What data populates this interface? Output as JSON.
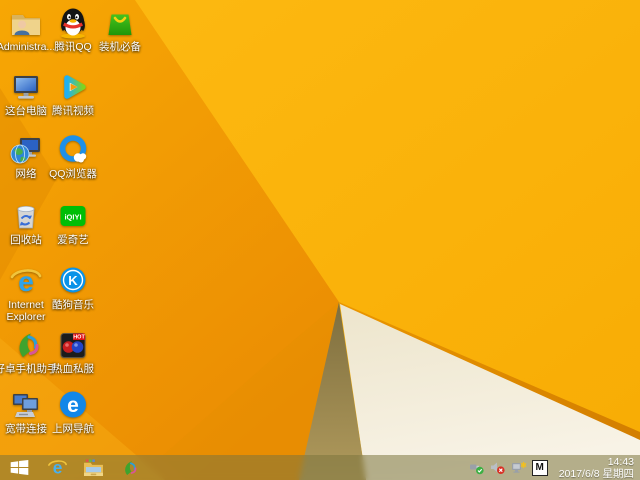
{
  "desktop": {
    "icons": [
      {
        "label": "Administra...",
        "name": "admin-folder"
      },
      {
        "label": "腾讯QQ",
        "name": "tencent-qq"
      },
      {
        "label": "装机必备",
        "name": "essential-apps"
      },
      {
        "label": "这台电脑",
        "name": "this-pc"
      },
      {
        "label": "腾讯视频",
        "name": "tencent-video"
      },
      {
        "label": "网络",
        "name": "network"
      },
      {
        "label": "QQ浏览器",
        "name": "qq-browser"
      },
      {
        "label": "回收站",
        "name": "recycle-bin"
      },
      {
        "label": "爱奇艺",
        "name": "iqiyi"
      },
      {
        "label": "Internet Explorer",
        "name": "internet-explorer"
      },
      {
        "label": "酷狗音乐",
        "name": "kugou-music"
      },
      {
        "label": "好卓手机助手",
        "name": "haozhuo-phone-assistant"
      },
      {
        "label": "热血私服",
        "name": "rexue-sifu"
      },
      {
        "label": "宽带连接",
        "name": "broadband-connection"
      },
      {
        "label": "上网导航",
        "name": "web-navigation"
      }
    ]
  },
  "icon_text": {
    "iqiyi": "iQIYI",
    "kugou": "K",
    "hot": "HOT",
    "ie": "e",
    "nav": "e"
  },
  "taskbar": {
    "tray": {
      "ime_indicator": "M",
      "time": "14:43",
      "date": "2017/6/8 星期四"
    }
  },
  "colors": {
    "wallpaper_yellow": "#FBB30B",
    "wallpaper_orange": "#EF9A04",
    "wallpaper_cream": "#F4EEDC",
    "wallpaper_olive": "#9C8950",
    "taskbar_tint": "#B89C42"
  }
}
